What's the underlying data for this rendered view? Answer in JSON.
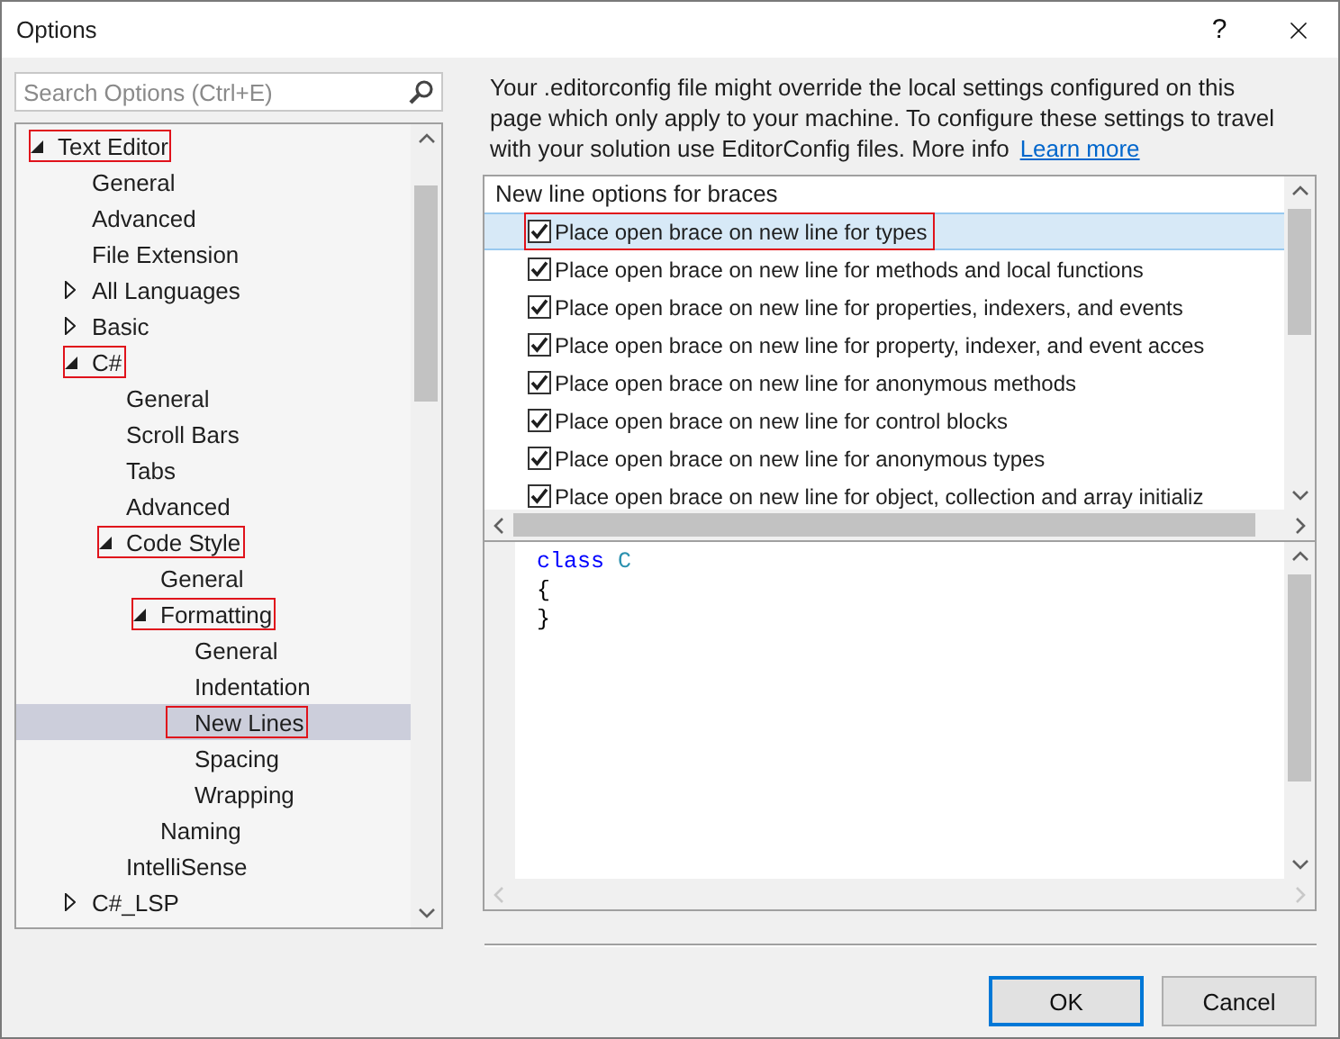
{
  "window": {
    "title": "Options",
    "help": "?"
  },
  "search": {
    "placeholder": "Search Options (Ctrl+E)"
  },
  "tree": {
    "items": [
      {
        "label": "Text Editor",
        "expanded": true,
        "selected": false,
        "highlighted": true,
        "children": [
          {
            "label": "General",
            "selected": false,
            "highlighted": false
          },
          {
            "label": "Advanced",
            "selected": false,
            "highlighted": false
          },
          {
            "label": "File Extension",
            "selected": false,
            "highlighted": false
          },
          {
            "label": "All Languages",
            "expanded": false,
            "selected": false,
            "highlighted": false
          },
          {
            "label": "Basic",
            "expanded": false,
            "selected": false,
            "highlighted": false
          },
          {
            "label": "C#",
            "expanded": true,
            "selected": false,
            "highlighted": true,
            "children": [
              {
                "label": "General",
                "selected": false,
                "highlighted": false
              },
              {
                "label": "Scroll Bars",
                "selected": false,
                "highlighted": false
              },
              {
                "label": "Tabs",
                "selected": false,
                "highlighted": false
              },
              {
                "label": "Advanced",
                "selected": false,
                "highlighted": false
              },
              {
                "label": "Code Style",
                "expanded": true,
                "selected": false,
                "highlighted": true,
                "children": [
                  {
                    "label": "General",
                    "selected": false,
                    "highlighted": false
                  },
                  {
                    "label": "Formatting",
                    "expanded": true,
                    "selected": false,
                    "highlighted": true,
                    "children": [
                      {
                        "label": "General",
                        "selected": false,
                        "highlighted": false
                      },
                      {
                        "label": "Indentation",
                        "selected": false,
                        "highlighted": false
                      },
                      {
                        "label": "New Lines",
                        "selected": true,
                        "highlighted": true
                      },
                      {
                        "label": "Spacing",
                        "selected": false,
                        "highlighted": false
                      },
                      {
                        "label": "Wrapping",
                        "selected": false,
                        "highlighted": false
                      }
                    ]
                  },
                  {
                    "label": "Naming",
                    "selected": false,
                    "highlighted": false
                  }
                ]
              },
              {
                "label": "IntelliSense",
                "selected": false,
                "highlighted": false
              }
            ]
          },
          {
            "label": "C#_LSP",
            "expanded": false,
            "selected": false,
            "highlighted": false
          }
        ]
      }
    ]
  },
  "info": {
    "text": "Your .editorconfig file might override the local settings configured on this page which only apply to your machine. To configure these settings to travel with your solution use EditorConfig files. More info",
    "link": "Learn more"
  },
  "options": {
    "heading": "New line options for braces",
    "rows": [
      {
        "label": "Place open brace on new line for types",
        "checked": true,
        "selected": true,
        "highlighted": true
      },
      {
        "label": "Place open brace on new line for methods and local functions",
        "checked": true,
        "selected": false,
        "highlighted": false
      },
      {
        "label": "Place open brace on new line for properties, indexers, and events",
        "checked": true,
        "selected": false,
        "highlighted": false
      },
      {
        "label": "Place open brace on new line for property, indexer, and event acces",
        "checked": true,
        "selected": false,
        "highlighted": false
      },
      {
        "label": "Place open brace on new line for anonymous methods",
        "checked": true,
        "selected": false,
        "highlighted": false
      },
      {
        "label": "Place open brace on new line for control blocks",
        "checked": true,
        "selected": false,
        "highlighted": false
      },
      {
        "label": "Place open brace on new line for anonymous types",
        "checked": true,
        "selected": false,
        "highlighted": false
      },
      {
        "label": "Place open brace on new line for object, collection and array initializ",
        "checked": true,
        "selected": false,
        "highlighted": false
      }
    ]
  },
  "preview": {
    "lines": [
      [
        {
          "text": "class",
          "kind": "keyword"
        },
        {
          "text": "C",
          "kind": "type"
        }
      ],
      [
        {
          "text": "{",
          "kind": "plain"
        }
      ],
      [
        {
          "text": "}",
          "kind": "plain"
        }
      ]
    ]
  },
  "buttons": [
    {
      "label": "OK",
      "default": true
    },
    {
      "label": "Cancel",
      "default": false
    }
  ]
}
